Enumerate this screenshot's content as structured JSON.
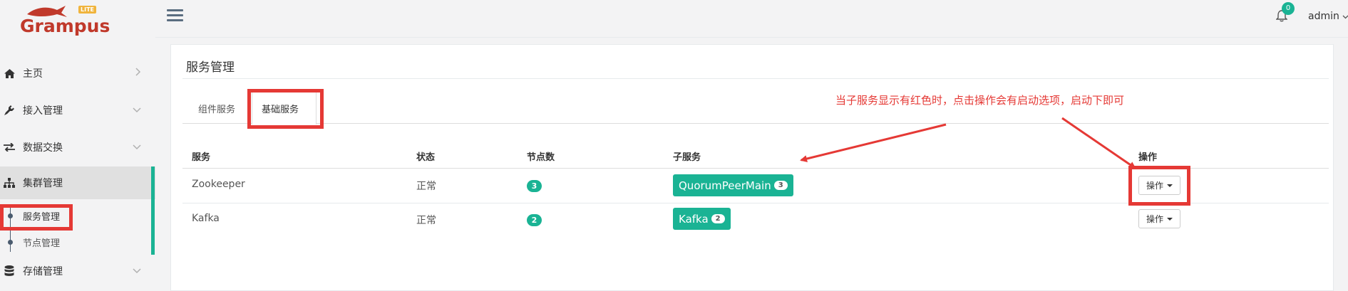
{
  "app": {
    "logo_text": "Grampus",
    "logo_badge": "LITE"
  },
  "sidebar": {
    "items": [
      {
        "label": "主页",
        "icon": "home-icon"
      },
      {
        "label": "接入管理",
        "icon": "plug-icon"
      },
      {
        "label": "数据交换",
        "icon": "exchange-icon"
      },
      {
        "label": "集群管理",
        "icon": "sitemap-icon"
      },
      {
        "label": "存储管理",
        "icon": "database-icon"
      }
    ],
    "sub_items": [
      {
        "label": "服务管理"
      },
      {
        "label": "节点管理"
      }
    ]
  },
  "topbar": {
    "notification_count": "0",
    "user": "admin"
  },
  "panel": {
    "title": "服务管理",
    "tabs": [
      {
        "label": "组件服务"
      },
      {
        "label": "基础服务"
      }
    ],
    "columns": [
      "服务",
      "状态",
      "节点数",
      "子服务",
      "操作"
    ],
    "rows": [
      {
        "service": "Zookeeper",
        "status": "正常",
        "nodes": "3",
        "sub_service": "QuorumPeerMain",
        "sub_count": "3",
        "action": "操作"
      },
      {
        "service": "Kafka",
        "status": "正常",
        "nodes": "2",
        "sub_service": "Kafka",
        "sub_count": "2",
        "action": "操作"
      }
    ]
  },
  "annotation": {
    "text": "当子服务显示有红色时，点击操作会有启动选项，启动下即可"
  },
  "colors": {
    "accent": "#1ab394",
    "annotation_red": "#e53935",
    "logo_red": "#c0392b"
  }
}
